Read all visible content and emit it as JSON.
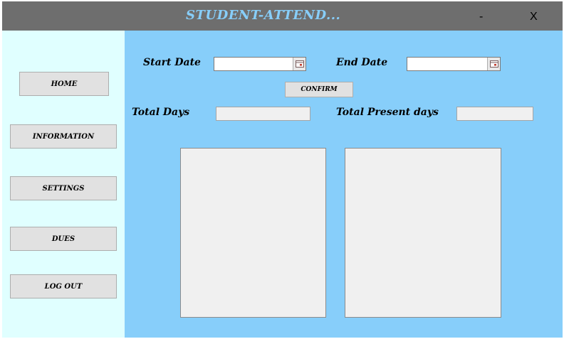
{
  "window": {
    "title": "STUDENT-ATTEND...",
    "minimize_label": "-",
    "close_label": "X"
  },
  "sidebar": {
    "items": [
      {
        "label": "HOME"
      },
      {
        "label": "INFORMATION"
      },
      {
        "label": "SETTINGS"
      },
      {
        "label": "DUES"
      },
      {
        "label": "LOG OUT"
      }
    ]
  },
  "form": {
    "start_date_label": "Start Date",
    "start_date_value": "",
    "end_date_label": "End Date",
    "end_date_value": "",
    "confirm_label": "CONFIRM",
    "total_days_label": "Total Days",
    "total_days_value": "",
    "total_present_label": "Total Present days",
    "total_present_value": ""
  },
  "colors": {
    "titlebar": "#6e6e6e",
    "title_text": "#87cefa",
    "sidebar_bg": "#e0ffff",
    "main_bg": "#87cefa",
    "button_bg": "#e1e1e1",
    "panel_bg": "#f0f0f0"
  },
  "icons": {
    "date_picker": "calendar-icon"
  }
}
